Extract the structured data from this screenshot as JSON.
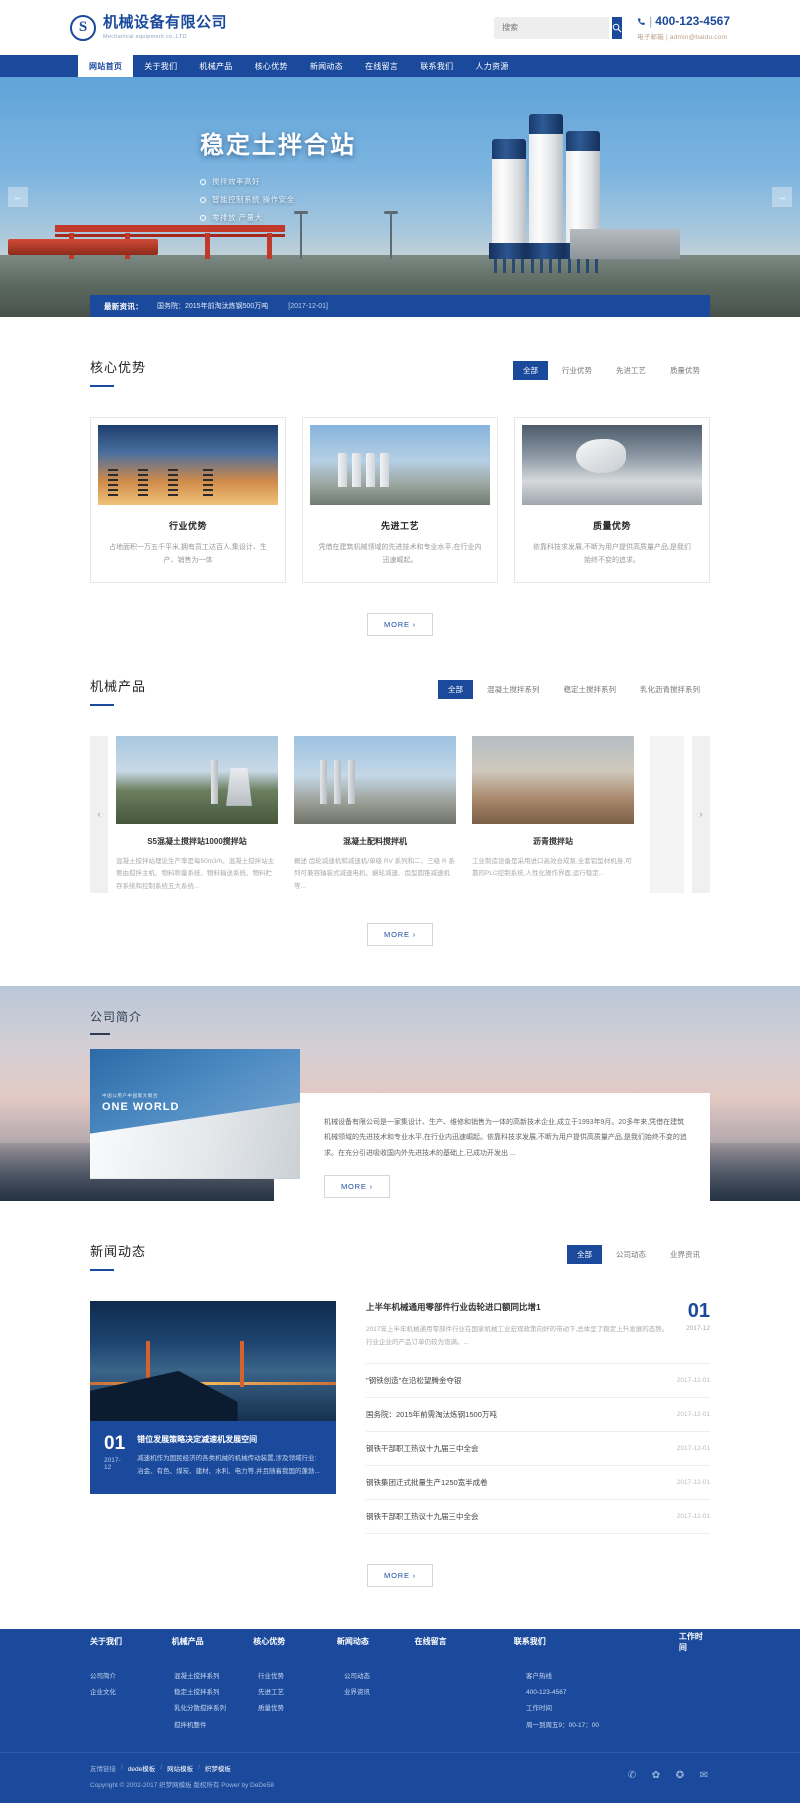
{
  "header": {
    "logo_cn": "机械设备有限公司",
    "logo_en": "Mechanical equipment co.,LTD",
    "logo_mark": "S",
    "search_placeholder": "搜索",
    "search_value": "",
    "search_icon": "search-icon",
    "phone_icon": "phone-icon",
    "phone": "400-123-4567",
    "phone_sep": "|",
    "email_label": "电子邮箱",
    "email": "admin@baidu.com"
  },
  "nav": {
    "items": [
      {
        "label": "网站首页",
        "active": true
      },
      {
        "label": "关于我们",
        "active": false
      },
      {
        "label": "机械产品",
        "active": false
      },
      {
        "label": "核心优势",
        "active": false
      },
      {
        "label": "新闻动态",
        "active": false
      },
      {
        "label": "在线留言",
        "active": false
      },
      {
        "label": "联系我们",
        "active": false
      },
      {
        "label": "人力资源",
        "active": false
      }
    ]
  },
  "hero": {
    "title": "稳定土拌合站",
    "bullets": [
      "搅拌效率高好",
      "智能控制系统 操作安全",
      "零排放 产量大"
    ],
    "prev_arrow": "←",
    "next_arrow": "→"
  },
  "ticker": {
    "label": "最新资讯：",
    "text": "国务院：2015年前淘汰炼钢500万吨",
    "date": "[2017-12-01]"
  },
  "advantages": {
    "title": "核心优势",
    "tabs": [
      {
        "label": "全部",
        "active": true
      },
      {
        "label": "行业优势",
        "active": false
      },
      {
        "label": "先进工艺",
        "active": false
      },
      {
        "label": "质量优势",
        "active": false
      }
    ],
    "cards": [
      {
        "name": "行业优势",
        "desc": "占地面积一万五千平米,拥有员工达百人,集设计、生产、销售为一体"
      },
      {
        "name": "先进工艺",
        "desc": "凭借在建筑机械领域的先进技术和专业水平,在行业内迅速崛起。"
      },
      {
        "name": "质量优势",
        "desc": "依靠科技求发展,不断为用户提供高质量产品,是我们始终不变的追求。"
      }
    ],
    "more_label": "MORE ›"
  },
  "products": {
    "title": "机械产品",
    "tabs": [
      {
        "label": "全部",
        "active": true
      },
      {
        "label": "混凝土搅拌系列",
        "active": false
      },
      {
        "label": "稳定土搅拌系列",
        "active": false
      },
      {
        "label": "乳化沥青搅拌系列",
        "active": false
      }
    ],
    "prev_arrow": "‹",
    "next_arrow": "›",
    "cards": [
      {
        "name": "S5混凝土搅拌站1000搅拌站",
        "desc": "混凝土搅拌站理论生产率是每50m3/h。混凝土搅拌站主要由搅拌主机、物料称量系统、物料输送系统、物料贮存系统和控制系统五大系统..."
      },
      {
        "name": "混凝土配料搅拌机",
        "desc": "概述 齿轮减速机和减速机/单级 RV 系列和二、三级 R 系列可兼容轴装式减速电机、蜗轮减速、齿型圆锥减速机等..."
      },
      {
        "name": "沥青搅拌站",
        "desc": "工业制造设备是采用进口高效合成泵,全套铝型材机身,可靠的PLC控制系统,人性化操作界面,运行稳定..."
      }
    ],
    "more_label": "MORE ›"
  },
  "about": {
    "title": "公司简介",
    "photo_cap_cn": "中国公用户中国家大联合",
    "photo_cap_en": "ONE WORLD",
    "text": "机械设备有限公司是一家集设计、生产、维修和销售为一体的高新技术企业,成立于1993年9月。20多年来,凭借在建筑机械领域的先进技术和专业水平,在行业内迅速崛起。依靠科技求发展,不断为用户提供高质量产品,是我们始终不变的追求。在充分引进吸收国内外先进技术的基础上,已成功开发出 ...",
    "more_label": "MORE ›"
  },
  "news": {
    "title": "新闻动态",
    "tabs": [
      {
        "label": "全部",
        "active": true
      },
      {
        "label": "公司动态",
        "active": false
      },
      {
        "label": "业界资讯",
        "active": false
      }
    ],
    "feature": {
      "day": "01",
      "ym": "2017-12",
      "title": "错位发展策略决定减速机发展空间",
      "desc": "减速机作为国民经济的各类机械的机械传动装置,涉及领域行业:冶金、有色、煤炭、建材、水利、电力等,并且随着我国的蓬勃..."
    },
    "top": {
      "title": "上半年机械通用零部件行业齿轮进口额同比增1",
      "desc": "2017年上半年机械通用零部件行业在国家机械工业宏观政策向好的带动下,总体呈了稳定上升发展的态势。行业企业的产品订单仍较为饱满。...",
      "day": "01",
      "ym": "2017-12"
    },
    "items": [
      {
        "title": "\"钢铁创造\"在沿松望腾金夺银",
        "date": "2017-12-01"
      },
      {
        "title": "国务院：2015年前需淘汰炼钢1500万吨",
        "date": "2017-12-01"
      },
      {
        "title": "钢铁干部职工热议十九届三中全会",
        "date": "2017-12-01"
      },
      {
        "title": "钢铁集团迁式批量生产1250宽半成卷",
        "date": "2017-12-01"
      },
      {
        "title": "钢铁干部职工热议十九届三中全会",
        "date": "2017-12-01"
      }
    ],
    "more_label": "MORE ›"
  },
  "footer": {
    "nav": [
      "关于我们",
      "机械产品",
      "核心优势",
      "新闻动态",
      "在线留言",
      "联系我们",
      "工作时间"
    ],
    "col_about": [
      "公司简介",
      "企业文化"
    ],
    "col_products": [
      "混凝土搅拌系列",
      "稳定土搅拌系列",
      "乳化分散搅拌系列",
      "搅拌机整件"
    ],
    "col_advantages": [
      "行业优势",
      "先进工艺",
      "质量优势"
    ],
    "col_news": [
      "公司动态",
      "业界资讯"
    ],
    "col_hours": [
      "客户热线",
      "400-123-4567",
      "工作时间",
      "周一到周五9：00-17：00"
    ],
    "friend_label": "友情链接",
    "friend_items": [
      "dede模板",
      "网站模板",
      "织梦模板"
    ],
    "friend_sep": "/",
    "copyright": "Copyright © 2002-2017 织梦网模板 版权所有 Power by DeDe58",
    "social": [
      "wechat-icon",
      "qq-icon",
      "weibo-icon",
      "mail-icon"
    ]
  }
}
